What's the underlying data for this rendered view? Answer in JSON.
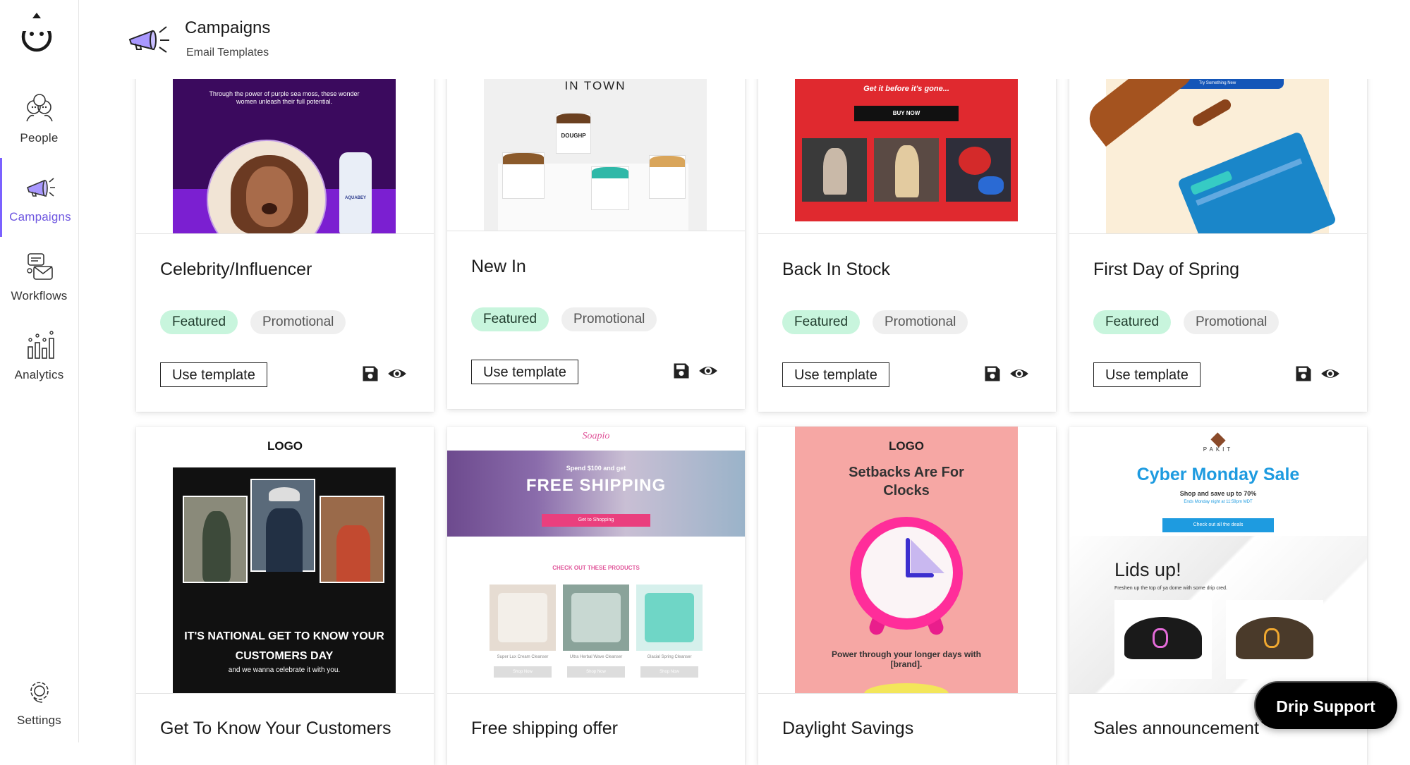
{
  "app": {
    "brand": "Drip"
  },
  "sidebar": {
    "items": [
      {
        "label": "People",
        "icon": "people-icon"
      },
      {
        "label": "Campaigns",
        "icon": "megaphone-icon",
        "active": true
      },
      {
        "label": "Workflows",
        "icon": "workflows-icon"
      },
      {
        "label": "Analytics",
        "icon": "analytics-icon"
      },
      {
        "label": "Settings",
        "icon": "gear-icon"
      }
    ]
  },
  "header": {
    "title": "Campaigns",
    "subtitle": "Email Templates",
    "icon": "megaphone-icon"
  },
  "tags": {
    "featured": "Featured",
    "promotional": "Promotional"
  },
  "actions": {
    "use_template": "Use template",
    "save_icon": "save-icon",
    "preview_icon": "eye-icon"
  },
  "cards": [
    {
      "title": "Celebrity/Influencer",
      "thumb_text": "Through the power of purple sea moss, these wonder women unleash their full potential.",
      "bottle_label": "AQUABEY"
    },
    {
      "title": "New In",
      "thumb_text": "IN TOWN",
      "brand_label": "DOUGHP"
    },
    {
      "title": "Back In Stock",
      "thumb_text": "Get it before it's gone...",
      "thumb_button": "BUY NOW"
    },
    {
      "title": "First Day of Spring",
      "thumb_text": "Try Something New"
    },
    {
      "title": "Get To Know Your Customers",
      "thumb_logo": "LOGO",
      "thumb_text": "IT'S NATIONAL GET TO KNOW YOUR CUSTOMERS DAY",
      "thumb_sub": "and we wanna celebrate it with you."
    },
    {
      "title": "Free shipping offer",
      "thumb_logo": "Soapio",
      "thumb_pre": "Spend $100 and get",
      "thumb_text": "FREE SHIPPING",
      "thumb_button": "Get to Shopping",
      "thumb_section": "CHECK OUT THESE PRODUCTS",
      "products": [
        "Super Lux Cream Cleanser",
        "Ultra Herbal Wave Cleanser",
        "Glacial Spring Cleanser"
      ],
      "product_button": "Shop Now"
    },
    {
      "title": "Daylight Savings",
      "thumb_logo": "LOGO",
      "thumb_text": "Setbacks Are For Clocks",
      "thumb_sub": "Power through your longer days with [brand]."
    },
    {
      "title": "Sales announcement",
      "thumb_logo": "PAKIT",
      "thumb_text": "Cyber Monday Sale",
      "thumb_sub": "Shop and save up to 70%",
      "thumb_fine": "Ends Monday night at 11:59pm MDT",
      "thumb_button": "Check out all the deals",
      "thumb_head2": "Lids up!",
      "thumb_sub2": "Freshen up the top of ya dome with some drip cred."
    }
  ],
  "support": {
    "label": "Drip Support"
  },
  "colors": {
    "accent": "#7b61ff",
    "featured_bg": "#c8f5dd",
    "tag_bg": "#efefef"
  }
}
